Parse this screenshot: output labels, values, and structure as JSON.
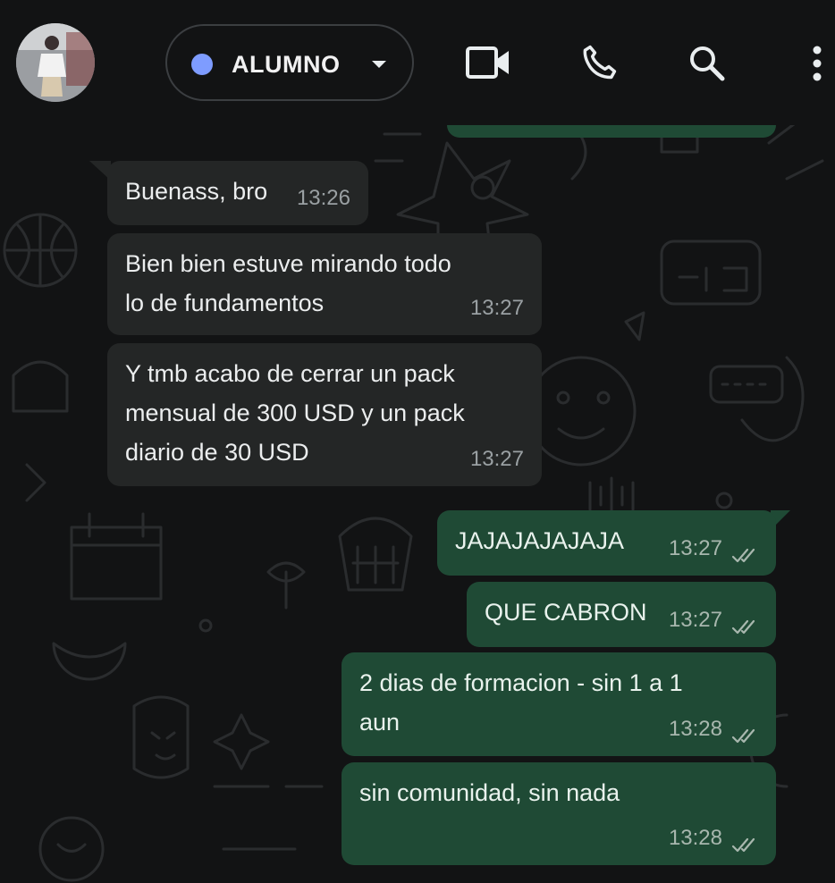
{
  "header": {
    "contact_name": "ALUMNO",
    "status_color": "#7e9cff",
    "icons": [
      "avatar",
      "chevron-down-icon",
      "video-call-icon",
      "voice-call-icon",
      "search-icon",
      "more-options-icon"
    ]
  },
  "colors": {
    "background": "#121314",
    "incoming_bubble": "#242626",
    "outgoing_bubble": "#1f4a35"
  },
  "messages": [
    {
      "direction": "in",
      "text": "Buenass, bro",
      "time": "13:26"
    },
    {
      "direction": "in",
      "text": "Bien bien estuve mirando todo\nlo de fundamentos",
      "time": "13:27"
    },
    {
      "direction": "in",
      "text": "Y tmb acabo de cerrar un pack\nmensual de 300 USD y un pack\ndiario de 30 USD",
      "time": "13:27"
    },
    {
      "direction": "out",
      "text": "JAJAJAJAJAJA",
      "time": "13:27",
      "status": "read-ticks-icon"
    },
    {
      "direction": "out",
      "text": "QUE CABRON",
      "time": "13:27",
      "status": "read-ticks-icon"
    },
    {
      "direction": "out",
      "text": "2 dias de formacion - sin 1 a 1\naun",
      "time": "13:28",
      "status": "read-ticks-icon"
    },
    {
      "direction": "out",
      "text": "sin comunidad, sin nada",
      "time": "13:28",
      "status": "read-ticks-icon"
    }
  ]
}
